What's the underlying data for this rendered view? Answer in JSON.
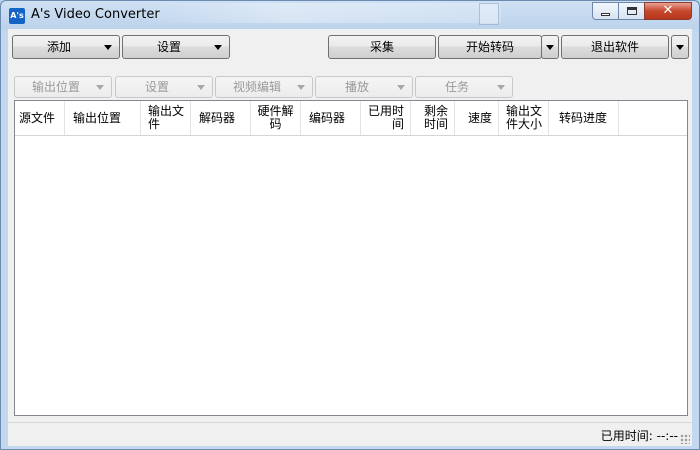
{
  "window": {
    "title": "A's Video Converter",
    "icon_text": "A's"
  },
  "toolbar": {
    "add": "添加",
    "settings": "设置",
    "capture": "采集",
    "start_transcode": "开始转码",
    "exit": "退出软件"
  },
  "subtoolbar": {
    "output_location": "输出位置",
    "settings": "设置",
    "video_edit": "视频编辑",
    "play": "播放",
    "task": "任务"
  },
  "table": {
    "columns": [
      "源文件",
      "输出位置",
      "输出文件",
      "解码器",
      "硬件解码",
      "编码器",
      "已用时间",
      "剩余时间",
      "速度",
      "输出文件大小",
      "转码进度"
    ],
    "rows": []
  },
  "status": {
    "elapsed": "已用时间: --:--"
  }
}
